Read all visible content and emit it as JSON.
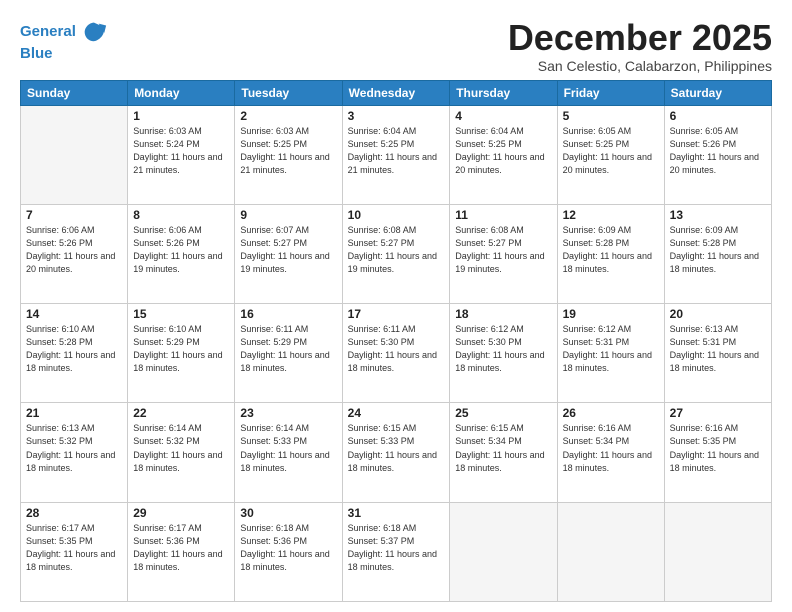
{
  "header": {
    "logo_line1": "General",
    "logo_line2": "Blue",
    "month": "December 2025",
    "location": "San Celestio, Calabarzon, Philippines"
  },
  "days_of_week": [
    "Sunday",
    "Monday",
    "Tuesday",
    "Wednesday",
    "Thursday",
    "Friday",
    "Saturday"
  ],
  "weeks": [
    [
      {
        "day": "",
        "empty": true
      },
      {
        "day": "1",
        "sunrise": "6:03 AM",
        "sunset": "5:24 PM",
        "daylight": "11 hours and 21 minutes."
      },
      {
        "day": "2",
        "sunrise": "6:03 AM",
        "sunset": "5:25 PM",
        "daylight": "11 hours and 21 minutes."
      },
      {
        "day": "3",
        "sunrise": "6:04 AM",
        "sunset": "5:25 PM",
        "daylight": "11 hours and 21 minutes."
      },
      {
        "day": "4",
        "sunrise": "6:04 AM",
        "sunset": "5:25 PM",
        "daylight": "11 hours and 20 minutes."
      },
      {
        "day": "5",
        "sunrise": "6:05 AM",
        "sunset": "5:25 PM",
        "daylight": "11 hours and 20 minutes."
      },
      {
        "day": "6",
        "sunrise": "6:05 AM",
        "sunset": "5:26 PM",
        "daylight": "11 hours and 20 minutes."
      }
    ],
    [
      {
        "day": "7",
        "sunrise": "6:06 AM",
        "sunset": "5:26 PM",
        "daylight": "11 hours and 20 minutes."
      },
      {
        "day": "8",
        "sunrise": "6:06 AM",
        "sunset": "5:26 PM",
        "daylight": "11 hours and 19 minutes."
      },
      {
        "day": "9",
        "sunrise": "6:07 AM",
        "sunset": "5:27 PM",
        "daylight": "11 hours and 19 minutes."
      },
      {
        "day": "10",
        "sunrise": "6:08 AM",
        "sunset": "5:27 PM",
        "daylight": "11 hours and 19 minutes."
      },
      {
        "day": "11",
        "sunrise": "6:08 AM",
        "sunset": "5:27 PM",
        "daylight": "11 hours and 19 minutes."
      },
      {
        "day": "12",
        "sunrise": "6:09 AM",
        "sunset": "5:28 PM",
        "daylight": "11 hours and 18 minutes."
      },
      {
        "day": "13",
        "sunrise": "6:09 AM",
        "sunset": "5:28 PM",
        "daylight": "11 hours and 18 minutes."
      }
    ],
    [
      {
        "day": "14",
        "sunrise": "6:10 AM",
        "sunset": "5:28 PM",
        "daylight": "11 hours and 18 minutes."
      },
      {
        "day": "15",
        "sunrise": "6:10 AM",
        "sunset": "5:29 PM",
        "daylight": "11 hours and 18 minutes."
      },
      {
        "day": "16",
        "sunrise": "6:11 AM",
        "sunset": "5:29 PM",
        "daylight": "11 hours and 18 minutes."
      },
      {
        "day": "17",
        "sunrise": "6:11 AM",
        "sunset": "5:30 PM",
        "daylight": "11 hours and 18 minutes."
      },
      {
        "day": "18",
        "sunrise": "6:12 AM",
        "sunset": "5:30 PM",
        "daylight": "11 hours and 18 minutes."
      },
      {
        "day": "19",
        "sunrise": "6:12 AM",
        "sunset": "5:31 PM",
        "daylight": "11 hours and 18 minutes."
      },
      {
        "day": "20",
        "sunrise": "6:13 AM",
        "sunset": "5:31 PM",
        "daylight": "11 hours and 18 minutes."
      }
    ],
    [
      {
        "day": "21",
        "sunrise": "6:13 AM",
        "sunset": "5:32 PM",
        "daylight": "11 hours and 18 minutes."
      },
      {
        "day": "22",
        "sunrise": "6:14 AM",
        "sunset": "5:32 PM",
        "daylight": "11 hours and 18 minutes."
      },
      {
        "day": "23",
        "sunrise": "6:14 AM",
        "sunset": "5:33 PM",
        "daylight": "11 hours and 18 minutes."
      },
      {
        "day": "24",
        "sunrise": "6:15 AM",
        "sunset": "5:33 PM",
        "daylight": "11 hours and 18 minutes."
      },
      {
        "day": "25",
        "sunrise": "6:15 AM",
        "sunset": "5:34 PM",
        "daylight": "11 hours and 18 minutes."
      },
      {
        "day": "26",
        "sunrise": "6:16 AM",
        "sunset": "5:34 PM",
        "daylight": "11 hours and 18 minutes."
      },
      {
        "day": "27",
        "sunrise": "6:16 AM",
        "sunset": "5:35 PM",
        "daylight": "11 hours and 18 minutes."
      }
    ],
    [
      {
        "day": "28",
        "sunrise": "6:17 AM",
        "sunset": "5:35 PM",
        "daylight": "11 hours and 18 minutes."
      },
      {
        "day": "29",
        "sunrise": "6:17 AM",
        "sunset": "5:36 PM",
        "daylight": "11 hours and 18 minutes."
      },
      {
        "day": "30",
        "sunrise": "6:18 AM",
        "sunset": "5:36 PM",
        "daylight": "11 hours and 18 minutes."
      },
      {
        "day": "31",
        "sunrise": "6:18 AM",
        "sunset": "5:37 PM",
        "daylight": "11 hours and 18 minutes."
      },
      {
        "day": "",
        "empty": true
      },
      {
        "day": "",
        "empty": true
      },
      {
        "day": "",
        "empty": true
      }
    ]
  ]
}
